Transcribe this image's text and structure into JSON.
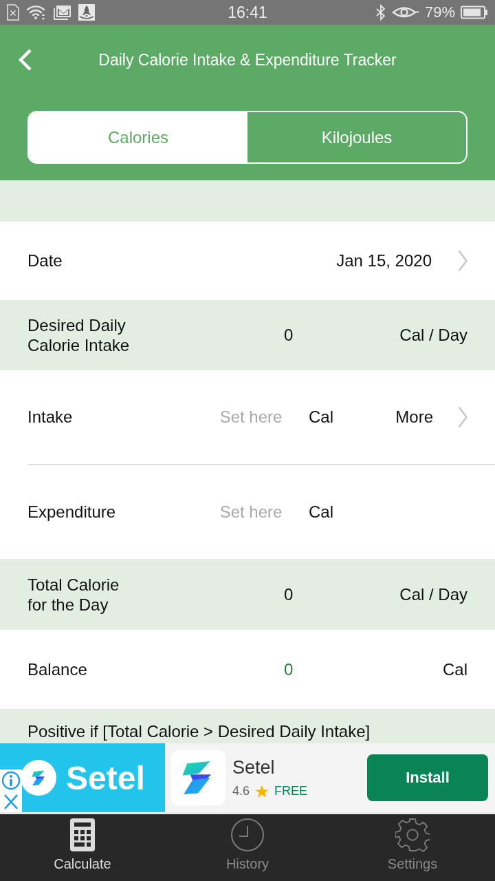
{
  "status_bar": {
    "time": "16:41",
    "battery": "79%"
  },
  "header": {
    "title": "Daily Calorie Intake & Expenditure Tracker"
  },
  "unit_tabs": [
    {
      "label": "Calories",
      "selected": true
    },
    {
      "label": "Kilojoules",
      "selected": false
    }
  ],
  "rows": [
    {
      "kind": "date",
      "label": "Date",
      "value": "Jan 15, 2020"
    },
    {
      "kind": "summary",
      "label": "Desired Daily Calorie Intake",
      "value": "0",
      "unit": "Cal / Day"
    },
    {
      "kind": "entry",
      "label": "Intake",
      "placeholder": "Set here",
      "unit": "Cal",
      "more": "More"
    },
    {
      "kind": "entry",
      "label": "Expenditure",
      "placeholder": "Set here",
      "unit": "Cal"
    },
    {
      "kind": "summary",
      "label": "Total Calorie for the Day",
      "value": "0",
      "unit": "Cal / Day"
    },
    {
      "kind": "balance",
      "label": "Balance",
      "value": "0",
      "unit": "Cal"
    },
    {
      "kind": "note",
      "text": "Positive if [Total Calorie > Desired Daily Intake]"
    }
  ],
  "ad": {
    "banner_text": "Setel",
    "app_name": "Setel",
    "rating": "4.6",
    "price": "FREE",
    "button": "Install"
  },
  "bottom_nav": [
    {
      "label": "Calculate",
      "selected": true
    },
    {
      "label": "History",
      "selected": false
    },
    {
      "label": "Settings",
      "selected": false
    }
  ]
}
